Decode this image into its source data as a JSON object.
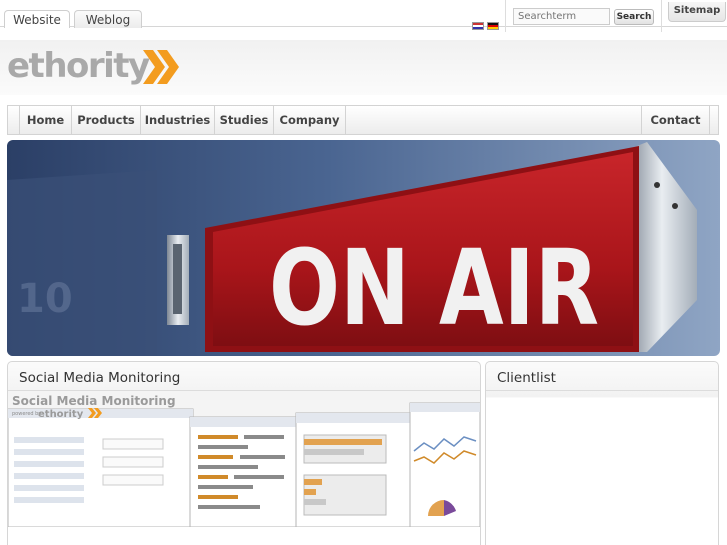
{
  "top_tabs": [
    {
      "label": "Website",
      "active": true
    },
    {
      "label": "Weblog",
      "active": false
    }
  ],
  "languages": [
    "english-flag-icon",
    "german-flag-icon"
  ],
  "search": {
    "placeholder": "Searchterm",
    "button_label": "Search"
  },
  "sitemap_label": "Sitemap",
  "logo": {
    "text": "ethority",
    "accent_color": "#f39c1f",
    "text_color": "#a9a9a9"
  },
  "nav": {
    "items": [
      "Home",
      "Products",
      "Industries",
      "Studies",
      "Company"
    ],
    "right_item": "Contact"
  },
  "hero": {
    "sign_text": "ON AIR",
    "sign_color": "#b3171b"
  },
  "panels": {
    "left": {
      "title": "Social Media Monitoring",
      "screenshot_title": "Social Media Monitoring",
      "screenshot_subtitle": "powered by",
      "screenshot_brand": "ethority"
    },
    "right": {
      "title": "Clientlist"
    }
  }
}
